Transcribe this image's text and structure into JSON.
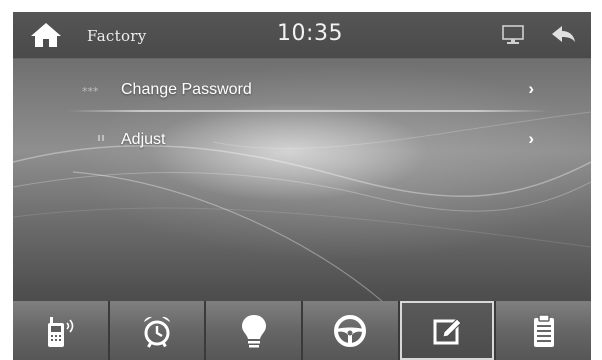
{
  "header": {
    "title": "Factory",
    "time": "10:35",
    "icons": {
      "home": "home-icon",
      "monitor": "monitor-icon",
      "back": "back-arrow-icon"
    }
  },
  "menu": {
    "items": [
      {
        "label": "Change Password",
        "icon": "asterisks-icon",
        "chevron": "›"
      },
      {
        "label": "Adjust",
        "icon": "adjust-marks-icon",
        "chevron": "›"
      }
    ]
  },
  "dock": {
    "buttons": [
      {
        "icon": "phone-bluetooth-icon",
        "active": false
      },
      {
        "icon": "alarm-clock-icon",
        "active": false
      },
      {
        "icon": "light-bulb-icon",
        "active": false
      },
      {
        "icon": "steering-wheel-icon",
        "active": false
      },
      {
        "icon": "edit-pencil-icon",
        "active": true
      },
      {
        "icon": "clipboard-icon",
        "active": false
      }
    ]
  },
  "colors": {
    "text": "#ffffff",
    "header_bg": "#4d4d4d",
    "dock_bg": "#6a6a6a",
    "active_border": "#d8d8d8"
  }
}
